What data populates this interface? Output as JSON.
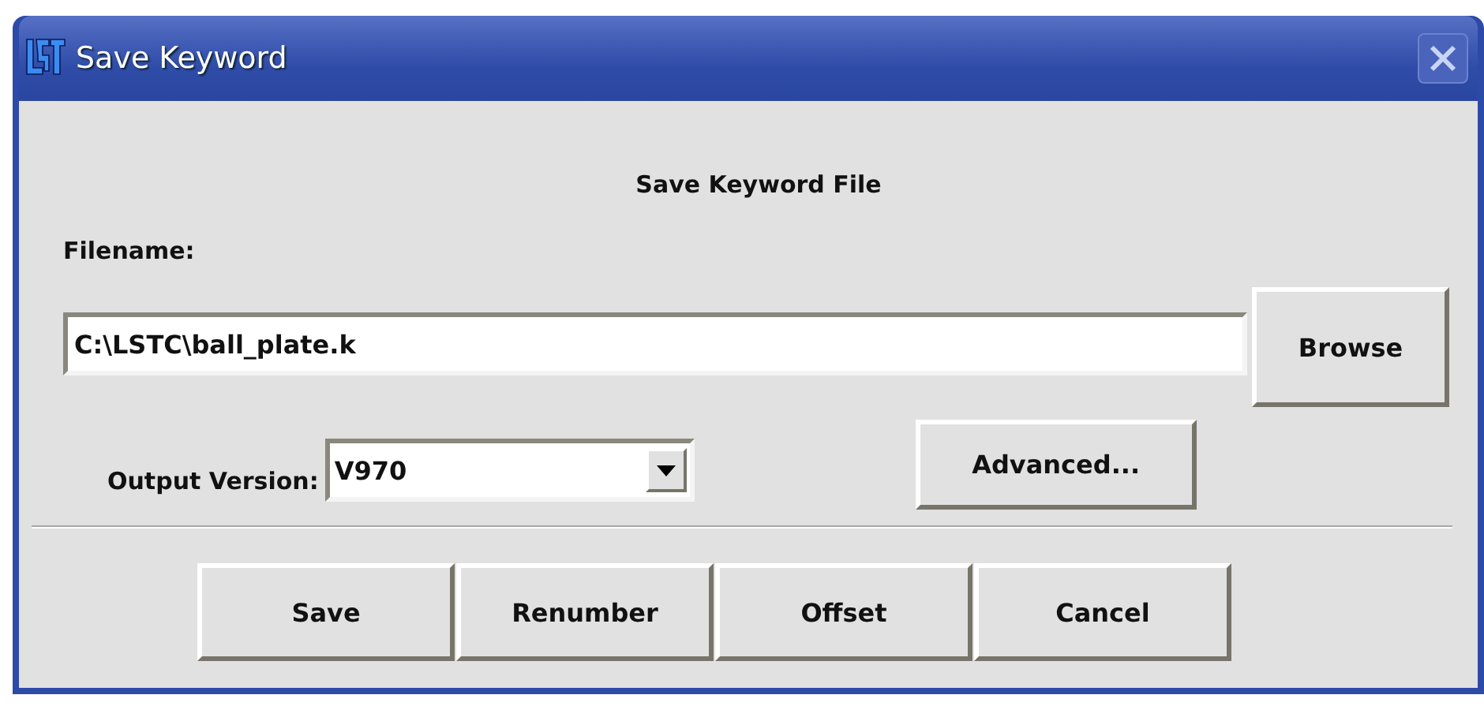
{
  "window": {
    "title": "Save Keyword"
  },
  "heading": "Save Keyword File",
  "filename": {
    "label": "Filename:",
    "value": "C:\\LSTC\\ball_plate.k"
  },
  "browse_button": "Browse",
  "output_version": {
    "label": "Output Version:",
    "value": "V970"
  },
  "advanced_button": "Advanced...",
  "buttons": [
    "Save",
    "Renumber",
    "Offset",
    "Cancel"
  ]
}
